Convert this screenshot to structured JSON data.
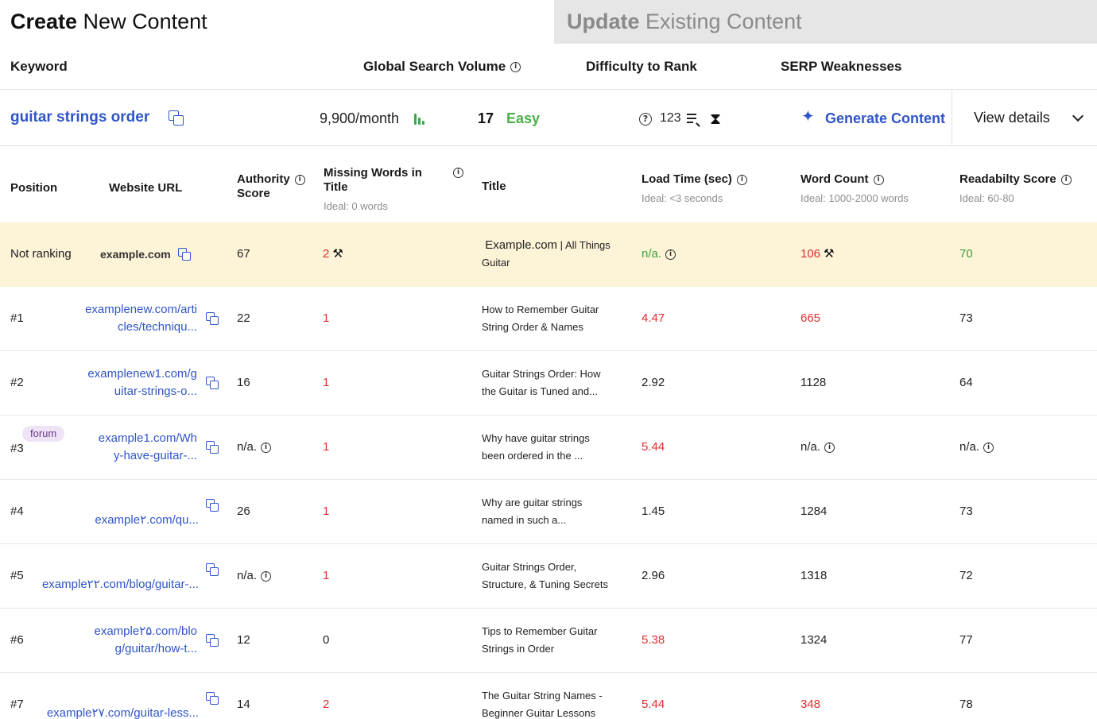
{
  "tabs": {
    "create_bold": "Create",
    "create_rest": " New Content",
    "update_bold": "Update",
    "update_rest": " Existing Content"
  },
  "keyword_header": {
    "keyword": "Keyword",
    "volume": "Global Search Volume",
    "difficulty": "Difficulty to Rank",
    "serp": "SERP Weaknesses"
  },
  "keyword_row": {
    "keyword": "guitar strings order",
    "volume": "9,900/month",
    "difficulty_score": "17",
    "difficulty_label": "Easy",
    "serp_count": "123",
    "generate_label": "Generate Content",
    "view_details": "View details"
  },
  "table_header": {
    "position": "Position",
    "url": "Website URL",
    "authority_1": "Authority",
    "authority_2": "Score",
    "missing_1": "Missing Words in",
    "missing_2": "Title",
    "missing_ideal": "Ideal: 0 words",
    "title": "Title",
    "load": "Load Time (sec)",
    "load_ideal": "Ideal: <3 seconds",
    "words": "Word Count",
    "words_ideal": "Ideal: 1000-2000 words",
    "read": "Readabilty Score",
    "read_ideal": "Ideal: 60-80"
  },
  "own_row": {
    "position": "Not ranking",
    "url": "example.com",
    "authority": "67",
    "missing": "2",
    "title_1": "Example.com",
    "title_2": " | All Things",
    "title_3": "Guitar",
    "load": "n/a.",
    "words": "106",
    "read": "70"
  },
  "rows": [
    {
      "position": "#1",
      "url_1": "examplenew.com/arti",
      "url_2": "cles/techniqu...",
      "authority": "22",
      "missing": "1",
      "title_1": "How to Remember Guitar",
      "title_2": "String Order & Names",
      "load": "4.47",
      "words": "665",
      "read": "73"
    },
    {
      "position": "#2",
      "url_1": "examplenew1.com/g",
      "url_2": "uitar-strings-o...",
      "authority": "16",
      "missing": "1",
      "title_1": "Guitar Strings Order: How",
      "title_2": "the Guitar is Tuned and...",
      "load": "2.92",
      "words": "1128",
      "read": "64"
    },
    {
      "position": "#3",
      "badge": "forum",
      "url_1": "example1.com/Wh",
      "url_2": "y-have-guitar-...",
      "authority": "n/a.",
      "missing": "1",
      "title_1": "Why have guitar strings",
      "title_2": "been ordered in the ...",
      "load": "5.44",
      "words": "n/a.",
      "read": "n/a."
    },
    {
      "position": "#4",
      "url_1": "",
      "url_2": "example۲.com/qu...",
      "authority": "26",
      "missing": "1",
      "title_1": "Why are guitar strings",
      "title_2": "named in such a...",
      "load": "1.45",
      "words": "1284",
      "read": "73"
    },
    {
      "position": "#5",
      "url_1": "",
      "url_2": "example۲۲.com/blog/guitar-...",
      "authority": "n/a.",
      "missing": "1",
      "title_1": "Guitar Strings Order,",
      "title_2": "Structure, & Tuning Secrets",
      "load": "2.96",
      "words": "1318",
      "read": "72"
    },
    {
      "position": "#6",
      "url_1": "example۲۵.com/blo",
      "url_2": "g/guitar/how-t...",
      "authority": "12",
      "missing": "0",
      "title_1": "Tips to Remember Guitar",
      "title_2": "Strings in Order",
      "load": "5.38",
      "words": "1324",
      "read": "77"
    },
    {
      "position": "#7",
      "url_1": "",
      "url_2": "example۲۷.com/guitar-less...",
      "authority": "14",
      "missing": "2",
      "title_1": "The Guitar String Names -",
      "title_2": "Beginner Guitar Lessons",
      "load": "5.44",
      "words": "348",
      "read": "78"
    }
  ],
  "colors": {
    "link": "#2f55c8",
    "bad": "#e0302e",
    "good": "#3ba33b",
    "highlight": "#fdf3d7"
  }
}
